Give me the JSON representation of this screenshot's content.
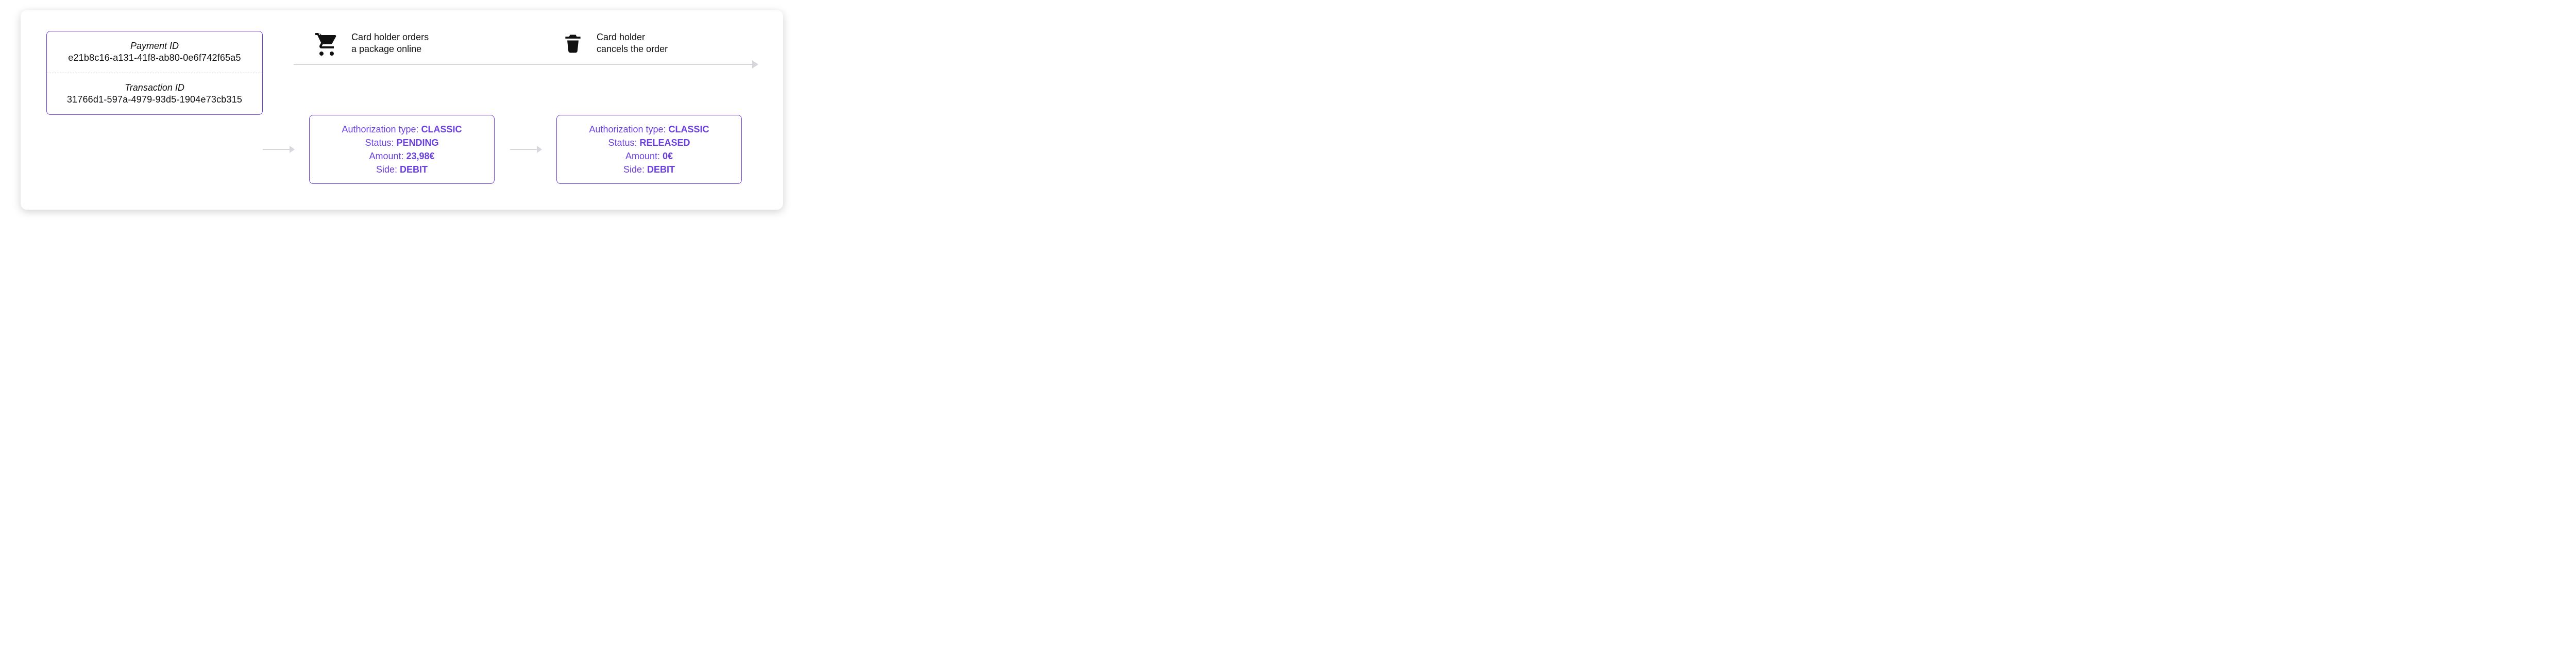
{
  "payment": {
    "label": "Payment ID",
    "value": "e21b8c16-a131-41f8-ab80-0e6f742f65a5"
  },
  "transaction": {
    "label": "Transaction ID",
    "value": "31766d1-597a-4979-93d5-1904e73cb315"
  },
  "events": [
    {
      "icon": "cart",
      "line1": "Card holder orders",
      "line2": "a package online"
    },
    {
      "icon": "trash",
      "line1": "Card holder",
      "line2": "cancels the order"
    }
  ],
  "auth_label_type": "Authorization type:",
  "auth_label_status": "Status:",
  "auth_label_amount": "Amount:",
  "auth_label_side": "Side:",
  "authorizations": [
    {
      "type": "CLASSIC",
      "status": "PENDING",
      "amount": "23,98€",
      "side": "DEBIT"
    },
    {
      "type": "CLASSIC",
      "status": "RELEASED",
      "amount": "0€",
      "side": "DEBIT"
    }
  ]
}
